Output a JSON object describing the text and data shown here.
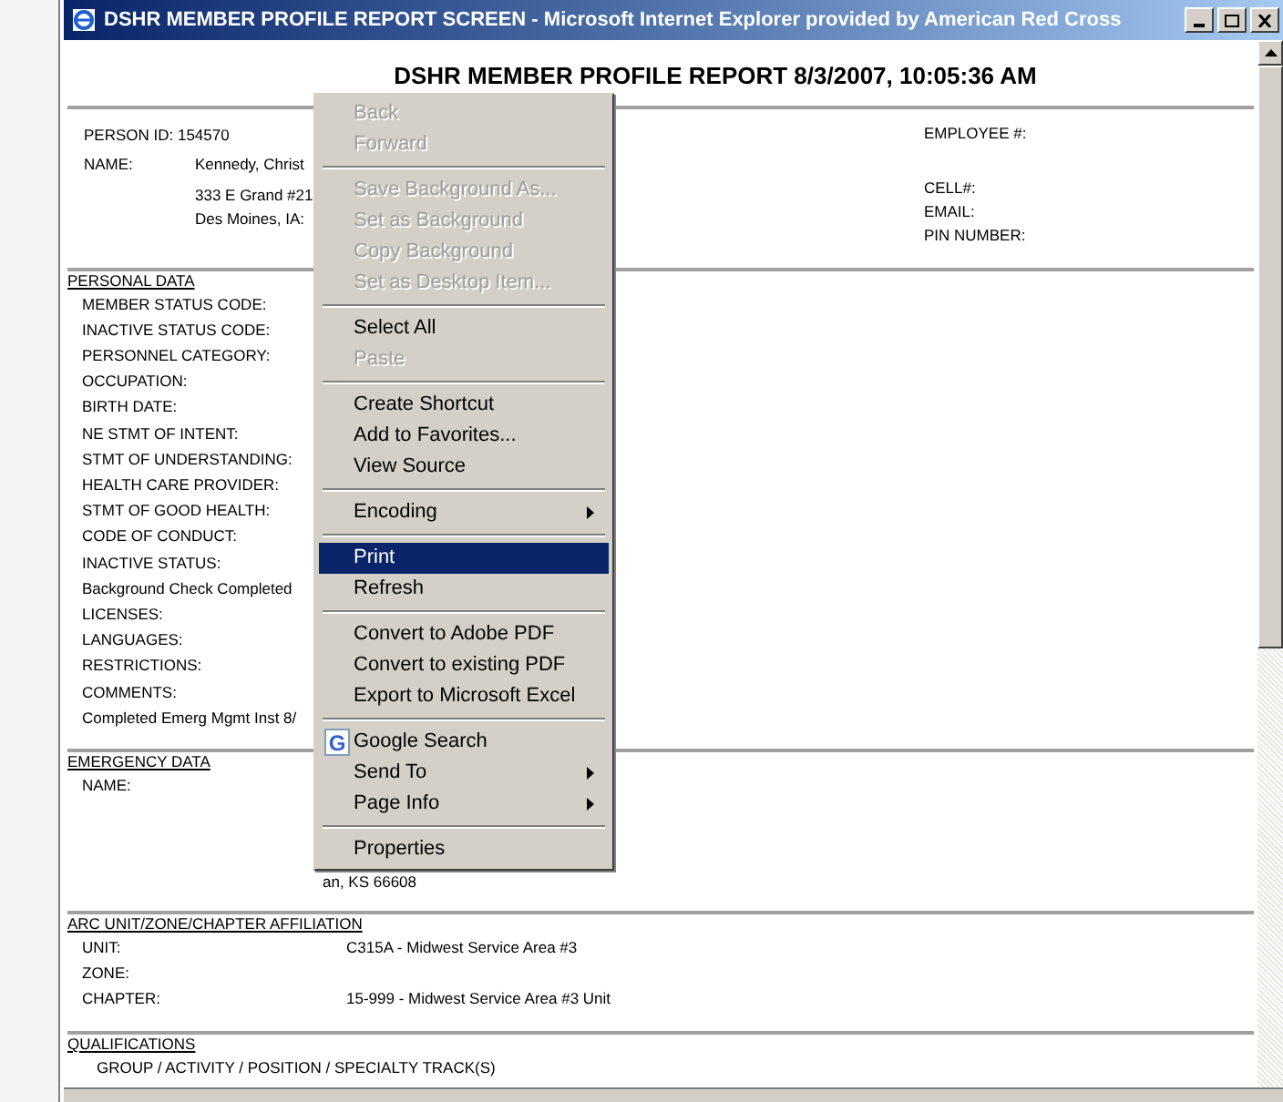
{
  "window": {
    "title": "DSHR MEMBER PROFILE REPORT SCREEN - Microsoft Internet Explorer provided by American Red Cross"
  },
  "report": {
    "title": "DSHR MEMBER PROFILE REPORT 8/3/2007, 10:05:36 AM",
    "person": {
      "id_label": "PERSON ID: 154570",
      "name_label": "NAME:",
      "name_lines": [
        "Kennedy, Christ",
        "333 E Grand #21",
        "Des Moines, IA:"
      ],
      "contact_groups": [
        [
          "EMPLOYEE #:"
        ],
        [
          "CELL#:",
          "EMAIL:",
          "PIN NUMBER:"
        ]
      ]
    },
    "sections": [
      {
        "heading": "PERSONAL DATA",
        "rows": [
          {
            "kind": "field",
            "label": "MEMBER STATUS CODE:"
          },
          {
            "kind": "field",
            "label": "INACTIVE STATUS CODE:"
          },
          {
            "kind": "field",
            "label": "PERSONNEL CATEGORY:"
          },
          {
            "kind": "field",
            "label": "OCCUPATION:"
          },
          {
            "kind": "field",
            "label": "BIRTH DATE:"
          },
          {
            "kind": "field",
            "label": "NE STMT OF INTENT:"
          },
          {
            "kind": "field",
            "label": "STMT OF UNDERSTANDING:"
          },
          {
            "kind": "field",
            "label": "HEALTH CARE PROVIDER:"
          },
          {
            "kind": "field",
            "label": "STMT OF GOOD HEALTH:"
          },
          {
            "kind": "field",
            "label": "CODE OF CONDUCT:"
          },
          {
            "kind": "field",
            "label": "INACTIVE STATUS:"
          },
          {
            "kind": "note",
            "label": "Background Check Completed"
          },
          {
            "kind": "field",
            "label": "LICENSES:"
          },
          {
            "kind": "field",
            "label": "LANGUAGES:"
          },
          {
            "kind": "field",
            "label": "RESTRICTIONS:"
          },
          {
            "kind": "field",
            "label": "COMMENTS:"
          },
          {
            "kind": "note",
            "label": "Completed Emerg Mgmt Inst 8/"
          }
        ]
      },
      {
        "heading": "EMERGENCY DATA",
        "rows": [
          {
            "kind": "field",
            "label": "NAME:"
          },
          {
            "kind": "address",
            "label": "an, KS 66608"
          }
        ]
      },
      {
        "heading": "ARC UNIT/ZONE/CHAPTER AFFILIATION",
        "rows": [
          {
            "kind": "field",
            "label": "UNIT:",
            "value": "C315A - Midwest Service Area #3"
          },
          {
            "kind": "field",
            "label": "ZONE:"
          },
          {
            "kind": "field",
            "label": "CHAPTER:",
            "value": "15-999 - Midwest Service Area #3 Unit"
          }
        ]
      },
      {
        "heading": "QUALIFICATIONS",
        "rows": [
          {
            "kind": "subheading",
            "label": "GROUP / ACTIVITY / POSITION / SPECIALTY TRACK(S)"
          }
        ]
      }
    ]
  },
  "context_menu": {
    "items": [
      {
        "kind": "item",
        "label": "Back",
        "disabled": true,
        "selected": false,
        "submenu": false
      },
      {
        "kind": "item",
        "label": "Forward",
        "disabled": true,
        "selected": false,
        "submenu": false
      },
      {
        "kind": "separator"
      },
      {
        "kind": "item",
        "label": "Save Background As...",
        "disabled": true,
        "selected": false,
        "submenu": false
      },
      {
        "kind": "item",
        "label": "Set as Background",
        "disabled": true,
        "selected": false,
        "submenu": false
      },
      {
        "kind": "item",
        "label": "Copy Background",
        "disabled": true,
        "selected": false,
        "submenu": false
      },
      {
        "kind": "item",
        "label": "Set as Desktop Item...",
        "disabled": true,
        "selected": false,
        "submenu": false
      },
      {
        "kind": "separator"
      },
      {
        "kind": "item",
        "label": "Select All",
        "disabled": false,
        "selected": false,
        "submenu": false
      },
      {
        "kind": "item",
        "label": "Paste",
        "disabled": true,
        "selected": false,
        "submenu": false
      },
      {
        "kind": "separator"
      },
      {
        "kind": "item",
        "label": "Create Shortcut",
        "disabled": false,
        "selected": false,
        "submenu": false
      },
      {
        "kind": "item",
        "label": "Add to Favorites...",
        "disabled": false,
        "selected": false,
        "submenu": false
      },
      {
        "kind": "item",
        "label": "View Source",
        "disabled": false,
        "selected": false,
        "submenu": false
      },
      {
        "kind": "separator"
      },
      {
        "kind": "item",
        "label": "Encoding",
        "disabled": false,
        "selected": false,
        "submenu": true
      },
      {
        "kind": "separator"
      },
      {
        "kind": "item",
        "label": "Print",
        "disabled": false,
        "selected": true,
        "submenu": false
      },
      {
        "kind": "item",
        "label": "Refresh",
        "disabled": false,
        "selected": false,
        "submenu": false
      },
      {
        "kind": "separator"
      },
      {
        "kind": "item",
        "label": "Convert to Adobe PDF",
        "disabled": false,
        "selected": false,
        "submenu": false
      },
      {
        "kind": "item",
        "label": "Convert to existing PDF",
        "disabled": false,
        "selected": false,
        "submenu": false
      },
      {
        "kind": "item",
        "label": "Export to Microsoft Excel",
        "disabled": false,
        "selected": false,
        "submenu": false
      },
      {
        "kind": "separator"
      },
      {
        "kind": "google",
        "label": "Google Search",
        "glyph": "G",
        "disabled": false,
        "selected": false,
        "submenu": false
      },
      {
        "kind": "item",
        "label": "Send To",
        "disabled": false,
        "selected": false,
        "submenu": true
      },
      {
        "kind": "item",
        "label": "Page Info",
        "disabled": false,
        "selected": false,
        "submenu": true
      },
      {
        "kind": "separator"
      },
      {
        "kind": "item",
        "label": "Properties",
        "disabled": false,
        "selected": false,
        "submenu": false
      }
    ]
  }
}
